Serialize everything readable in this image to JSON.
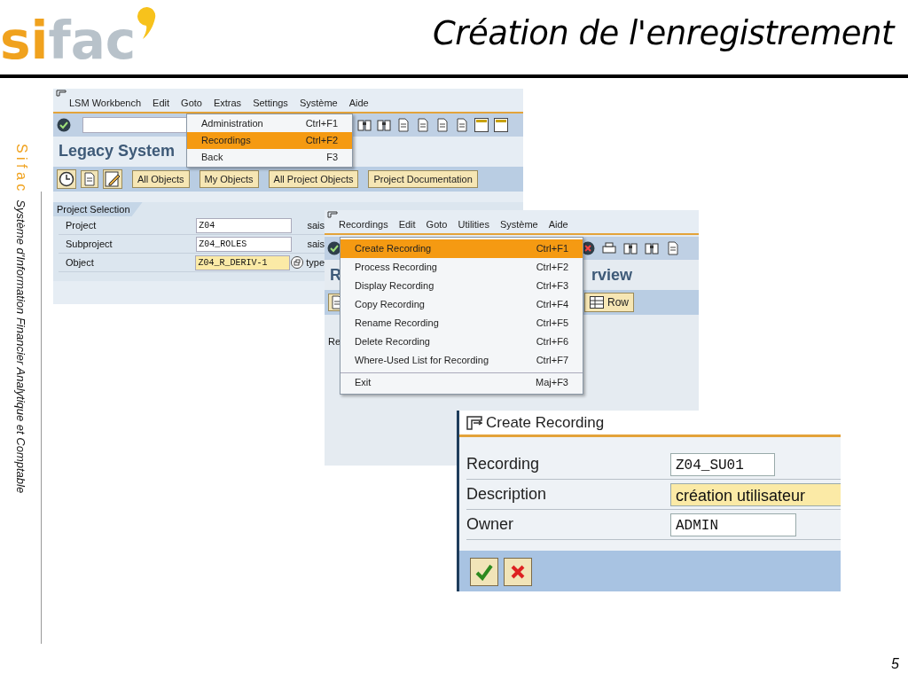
{
  "slide": {
    "logo": {
      "accent": "si",
      "rest": "fac"
    },
    "title": "Création de l'enregistrement",
    "side_brand": "S i f a c",
    "side_caption": "Système d'Information Financier Analytique et Comptable",
    "page_number": "5"
  },
  "workbench": {
    "menu": [
      "LSM Workbench",
      "Edit",
      "Goto",
      "Extras",
      "Settings",
      "Système",
      "Aide"
    ],
    "dropdown": [
      {
        "label": "Administration",
        "shortcut": "Ctrl+F1",
        "selected": false
      },
      {
        "label": "Recordings",
        "shortcut": "Ctrl+F2",
        "selected": true
      },
      {
        "label": "Back",
        "shortcut": "F3",
        "selected": false
      }
    ],
    "title": "Legacy System",
    "buttons": [
      "All Objects",
      "My Objects",
      "All Project Objects",
      "Project Documentation"
    ],
    "group_title": "Project Selection",
    "fields": [
      {
        "label": "Project",
        "value": "Z04",
        "required": false,
        "note": "sais"
      },
      {
        "label": "Subproject",
        "value": "Z04_ROLES",
        "required": false,
        "note": "sais"
      },
      {
        "label": "Object",
        "value": "Z04_R_DERIV-1",
        "required": true,
        "note": "type"
      }
    ]
  },
  "recordings": {
    "menu": [
      "Recordings",
      "Edit",
      "Goto",
      "Utilities",
      "Système",
      "Aide"
    ],
    "dropdown": [
      {
        "label": "Create Recording",
        "shortcut": "Ctrl+F1",
        "selected": true,
        "separator_before": false
      },
      {
        "label": "Process Recording",
        "shortcut": "Ctrl+F2",
        "selected": false,
        "separator_before": false
      },
      {
        "label": "Display Recording",
        "shortcut": "Ctrl+F3",
        "selected": false,
        "separator_before": false
      },
      {
        "label": "Copy Recording",
        "shortcut": "Ctrl+F4",
        "selected": false,
        "separator_before": false
      },
      {
        "label": "Rename Recording",
        "shortcut": "Ctrl+F5",
        "selected": false,
        "separator_before": false
      },
      {
        "label": "Delete Recording",
        "shortcut": "Ctrl+F6",
        "selected": false,
        "separator_before": false
      },
      {
        "label": "Where-Used List for Recording",
        "shortcut": "Ctrl+F7",
        "selected": false,
        "separator_before": false
      },
      {
        "label": "Exit",
        "shortcut": "Maj+F3",
        "selected": false,
        "separator_before": true
      }
    ],
    "title_start": "R",
    "title_end": "rview",
    "row_button": "Row",
    "label_fragment": "Re"
  },
  "dialog": {
    "title": "Create Recording",
    "fields": [
      {
        "label": "Recording",
        "value": "Z04_SU01",
        "required": false,
        "kind": "code"
      },
      {
        "label": "Description",
        "value": "création utilisateur",
        "required": true,
        "kind": "text"
      },
      {
        "label": "Owner",
        "value": "ADMIN",
        "required": false,
        "kind": "code"
      }
    ]
  }
}
